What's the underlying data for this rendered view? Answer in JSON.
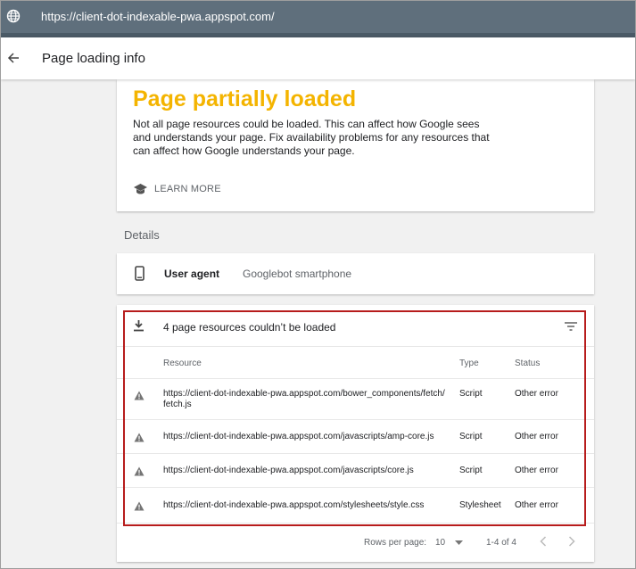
{
  "browser": {
    "url": "https://client-dot-indexable-pwa.appspot.com/"
  },
  "header": {
    "title": "Page loading info"
  },
  "status": {
    "title": "Page partially loaded",
    "description": "Not all page resources could be loaded. This can affect how Google sees and understands your page. Fix availability problems for any resources that can affect how Google understands your page.",
    "learn_more": "LEARN MORE",
    "title_color": "#f4b400"
  },
  "details": {
    "label": "Details",
    "user_agent_label": "User agent",
    "user_agent_value": "Googlebot smartphone"
  },
  "resources": {
    "heading": "4 page resources couldn’t be loaded",
    "columns": {
      "resource": "Resource",
      "type": "Type",
      "status": "Status"
    },
    "rows": [
      {
        "resource": "https://client-dot-indexable-pwa.appspot.com/bower_components/fetch/fetch.js",
        "type": "Script",
        "status": "Other error"
      },
      {
        "resource": "https://client-dot-indexable-pwa.appspot.com/javascripts/amp-core.js",
        "type": "Script",
        "status": "Other error"
      },
      {
        "resource": "https://client-dot-indexable-pwa.appspot.com/javascripts/core.js",
        "type": "Script",
        "status": "Other error"
      },
      {
        "resource": "https://client-dot-indexable-pwa.appspot.com/stylesheets/style.css",
        "type": "Stylesheet",
        "status": "Other error"
      }
    ],
    "pagination": {
      "rows_per_page_label": "Rows per page:",
      "rows_per_page_value": "10",
      "range": "1-4 of 4"
    }
  },
  "colors": {
    "highlight_border": "#b71c1c",
    "url_bar": "#5f6f7c",
    "warning_icon": "#757575"
  }
}
